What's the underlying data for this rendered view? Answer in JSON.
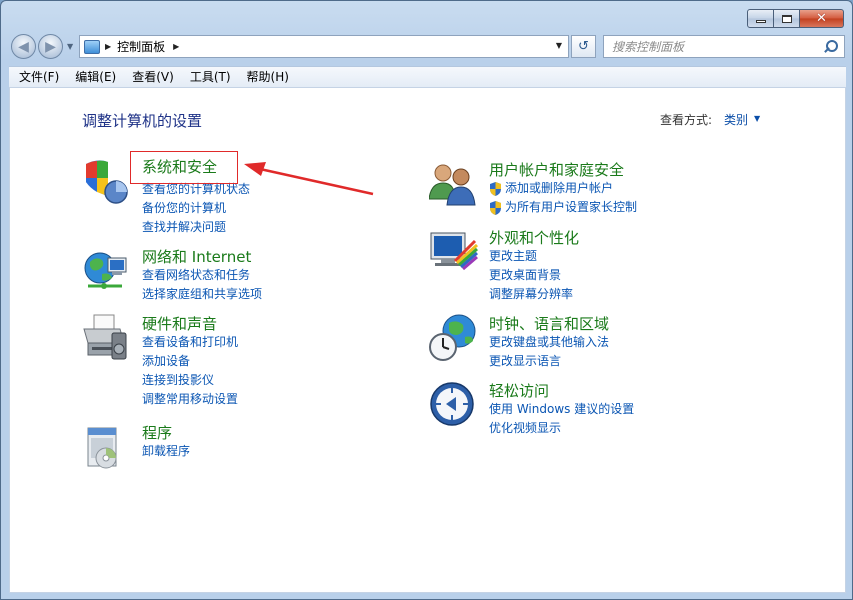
{
  "window": {
    "caption": {
      "minimize": "─",
      "maximize": "□",
      "close": "✕"
    }
  },
  "nav": {
    "address_path": [
      "控制面板"
    ],
    "search_placeholder": "搜索控制面板"
  },
  "menubar": {
    "items": [
      "文件(F)",
      "编辑(E)",
      "查看(V)",
      "工具(T)",
      "帮助(H)"
    ]
  },
  "main": {
    "heading": "调整计算机的设置",
    "view_by_label": "查看方式:",
    "view_by_value": "类别"
  },
  "categories_left": [
    {
      "title": "系统和安全",
      "icon": "shield-icon",
      "links": [
        "查看您的计算机状态",
        "备份您的计算机",
        "查找并解决问题"
      ]
    },
    {
      "title": "网络和 Internet",
      "icon": "network-globe-icon",
      "links": [
        "查看网络状态和任务",
        "选择家庭组和共享选项"
      ]
    },
    {
      "title": "硬件和声音",
      "icon": "printer-icon",
      "links": [
        "查看设备和打印机",
        "添加设备",
        "连接到投影仪",
        "调整常用移动设置"
      ]
    },
    {
      "title": "程序",
      "icon": "programs-icon",
      "links": [
        "卸载程序"
      ]
    }
  ],
  "categories_right": [
    {
      "title": "用户帐户和家庭安全",
      "icon": "users-icon",
      "links": [
        "添加或删除用户帐户",
        "为所有用户设置家长控制"
      ]
    },
    {
      "title": "外观和个性化",
      "icon": "monitor-palette-icon",
      "links": [
        "更改主题",
        "更改桌面背景",
        "调整屏幕分辨率"
      ]
    },
    {
      "title": "时钟、语言和区域",
      "icon": "clock-globe-icon",
      "links": [
        "更改键盘或其他输入法",
        "更改显示语言"
      ]
    },
    {
      "title": "轻松访问",
      "icon": "ease-of-access-icon",
      "links": [
        "使用 Windows 建议的设置",
        "优化视频显示"
      ]
    }
  ],
  "annotation": {
    "color": "#e02a2a"
  },
  "colors": {
    "category_title": "#1a7a1a",
    "link": "#0b56b3",
    "heading": "#1e3287"
  }
}
